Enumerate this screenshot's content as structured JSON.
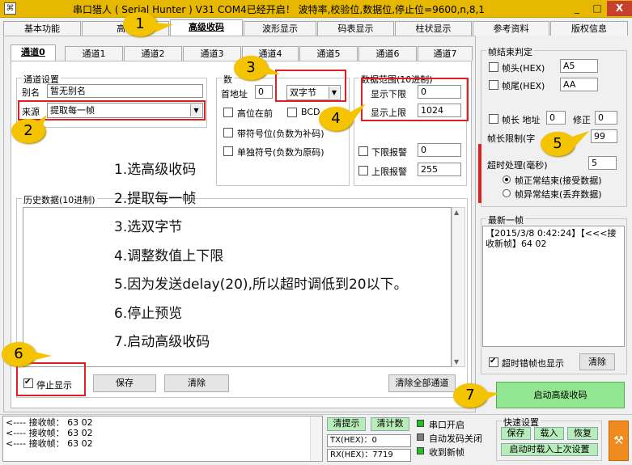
{
  "window": {
    "title": "串口猎人 ( Serial Hunter ) V31    COM4已经开启！ 波特率,校验位,数据位,停止位=9600,n,8,1",
    "min_label": "_",
    "max_label": "□",
    "close_label": "X"
  },
  "main_tabs": [
    "基本功能",
    "高级",
    "高级收码",
    "波形显示",
    "码表显示",
    "柱状显示",
    "参考资料",
    "版权信息"
  ],
  "channel_tabs": [
    "通道0",
    "通道1",
    "通道2",
    "通道3",
    "通道4",
    "通道5",
    "通道6",
    "通道7"
  ],
  "channel_settings": {
    "group_label": "通道设置",
    "alias_label": "别名",
    "alias_value": "暂无别名",
    "source_label": "来源",
    "source_value": "提取每一帧"
  },
  "data_group": {
    "label": "数",
    "addr_label": "首地址",
    "addr_value": "0",
    "bytes_value": "双字节",
    "high_first": "高位在前",
    "bcd": "BCD",
    "signed_label": "带符号位(负数为补码)",
    "sep_sign_label": "单独符号(负数为原码)"
  },
  "range_group": {
    "label": "数据范围(10进制)",
    "low_label": "显示下限",
    "low_value": "0",
    "high_label": "显示上限",
    "high_value": "1024",
    "low_alarm_label": "下限报警",
    "low_alarm_value": "0",
    "high_alarm_label": "上限报警",
    "high_alarm_value": "255"
  },
  "history": {
    "label": "历史数据(10进制)",
    "stop_label": "停止显示",
    "save_label": "保存",
    "clear_label": "清除",
    "clear_all_label": "清除全部通道"
  },
  "steps": [
    "1.选高级收码",
    "2.提取每一帧",
    "3.选双字节",
    "4.调整数值上下限",
    "5.因为发送delay(20),所以超时调低到20以下。",
    "6.停止预览",
    "7.启动高级收码"
  ],
  "frame_end": {
    "label": "帧结束判定",
    "head_label": "帧头(HEX)",
    "head_value": "A5",
    "tail_label": "帧尾(HEX)",
    "tail_value": "AA",
    "len_label": "帧长 地址",
    "len_addr": "0",
    "fix_label": "修正",
    "fix_value": "0",
    "limit_label": "帧长限制(字",
    "limit_value": "99",
    "timeout_label": "超时处理(毫秒)",
    "timeout_value": "5",
    "radio_normal": "帧正常结束(接受数据)",
    "radio_abnormal": "帧异常结束(丢弃数据)"
  },
  "latest": {
    "label": "最新一帧",
    "text": "【2015/3/8 0:42:24】【<<<接收新帧】64 02",
    "timeout_error_label": "超时错帧也显示",
    "clear_label": "清除"
  },
  "start_label": "启动高级收码",
  "log_lines": [
    "<---- 接收帧：  63 02",
    "<---- 接收帧：  63 02",
    "<---- 接收帧：  63 02"
  ],
  "status": {
    "clear_tip": "清提示",
    "clear_count": "清计数",
    "tx_label": "TX(HEX)：",
    "tx_value": "0",
    "rx_label": "RX(HEX)：",
    "rx_value": "7719",
    "port_open": "串口开启",
    "auto_send_off": "自动发码关闭",
    "new_frame": "收到新帧"
  },
  "quick": {
    "label": "快速设置",
    "save": "保存",
    "load": "载入",
    "restore": "恢复",
    "startup_load": "启动时载入上次设置"
  },
  "callouts": [
    "1",
    "2",
    "3",
    "4",
    "5",
    "6",
    "7"
  ],
  "colors": {
    "title_bar": "#e6b800",
    "callout": "#f5c400",
    "highlight_border": "#e02020",
    "start_button": "#92e692",
    "led_green": "#22c022",
    "led_gray": "#7d7d7d"
  }
}
